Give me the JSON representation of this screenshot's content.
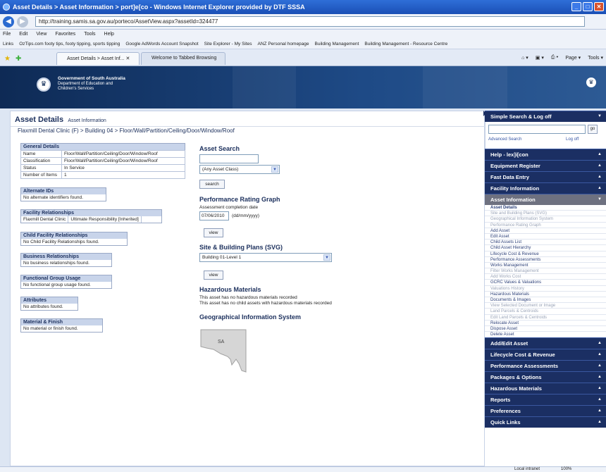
{
  "window": {
    "title": "Asset Details > Asset Information > port]e[co - Windows Internet Explorer provided by DTF SSSA",
    "url": "http://training.samis.sa.gov.au/porteco/AssetView.aspx?assetId=324477"
  },
  "menu": [
    "File",
    "Edit",
    "View",
    "Favorites",
    "Tools",
    "Help"
  ],
  "links": {
    "label": "Links",
    "items": [
      "OzTips.com footy tips, footy tipping, sports tipping",
      "Google AdWords Account Snapshot",
      "Site Explorer - My Sites",
      "ANZ Personal homepage",
      "Building Management",
      "Building Management - Resource Centre"
    ]
  },
  "tabs": [
    {
      "label": "Asset Details > Asset Inf..."
    },
    {
      "label": "Welcome to Tabbed Browsing"
    }
  ],
  "toolbar_right": [
    "Page ▾",
    "Tools ▾"
  ],
  "banner": {
    "line1": "Government of South Australia",
    "line2": "Department of Education and",
    "line3": "Children's Services"
  },
  "page": {
    "title": "Asset Details",
    "subtitle": "Asset Information",
    "path": "Flaxmill Dental Clinic (F) > Building 04 > Floor/Wall/Partition/Ceiling/Door/Window/Roof"
  },
  "general_details": {
    "header": "General Details",
    "rows": [
      {
        "label": "Name",
        "value": "Floor/Wall/Partition/Ceiling/Door/Window/Roof"
      },
      {
        "label": "Classification",
        "value": "Floor/Wall/Partition/Ceiling/Door/Window/Roof"
      },
      {
        "label": "Status",
        "value": "In Service"
      },
      {
        "label": "Number of Items",
        "value": "1"
      }
    ]
  },
  "panels": {
    "alt_ids": {
      "header": "Alternate IDs",
      "body": "No alternate identifiers found."
    },
    "facility": {
      "header": "Facility Relationships",
      "col1": "Flaxmill Dental Clinic",
      "col2": "Ultimate Responsibility [Inherited]"
    },
    "child_facility": {
      "header": "Child Facility Relationships",
      "body": "No Child Facility Relationships found."
    },
    "business": {
      "header": "Business Relationships",
      "body": "No business relationships found."
    },
    "functional": {
      "header": "Functional Group Usage",
      "body": "No functional group usage found."
    },
    "attributes": {
      "header": "Attributes",
      "body": "No attributes found."
    },
    "material": {
      "header": "Material & Finish",
      "body": "No material or finish found."
    }
  },
  "asset_search": {
    "header": "Asset Search",
    "input_value": "",
    "class_select": "(Any Asset Class)",
    "button": "search"
  },
  "rating_graph": {
    "header": "Performance Rating Graph",
    "date_label": "Assessment completion date",
    "date_value": "07/06/2010",
    "date_hint": "(dd/mm/yyyy)",
    "button": "view"
  },
  "site_plans": {
    "header": "Site & Building Plans (SVG)",
    "select": "Building 01-Level 1",
    "button": "view"
  },
  "hazardous": {
    "header": "Hazardous Materials",
    "line1": "This asset has no hazardous materials recorded",
    "line2": "This asset has no child assets with hazardous materials recorded"
  },
  "gis": {
    "header": "Geographical Information System",
    "map_label": "SA"
  },
  "sidebar": {
    "search_header": "Simple Search & Log off",
    "go": "go",
    "advanced": "Advanced Search",
    "logoff": "Log off",
    "sections_top": [
      "Help - lex]i[con",
      "Equipment Register",
      "Fast Data Entry",
      "Facility Information"
    ],
    "asset_info_header": "Asset Information",
    "asset_info_items": [
      {
        "label": "Asset Details",
        "state": "current"
      },
      {
        "label": "Site and Building Plans (SVG)",
        "state": "disabled"
      },
      {
        "label": "Geographical Information System",
        "state": "disabled"
      },
      {
        "label": "Performance Rating Graph",
        "state": "disabled"
      },
      {
        "label": "Add Asset",
        "state": "normal"
      },
      {
        "label": "Edit Asset",
        "state": "normal"
      },
      {
        "label": "Child Assets List",
        "state": "normal"
      },
      {
        "label": "Child Asset Hierarchy",
        "state": "normal"
      },
      {
        "label": "Lifecycle Cost & Revenue",
        "state": "normal"
      },
      {
        "label": "Performance Assessments",
        "state": "normal"
      },
      {
        "label": "Works Management",
        "state": "normal"
      },
      {
        "label": "Filter Works Management",
        "state": "disabled"
      },
      {
        "label": "Add Works Cost",
        "state": "disabled"
      },
      {
        "label": "GCRC Values & Valuations",
        "state": "normal"
      },
      {
        "label": "Valuations History",
        "state": "disabled"
      },
      {
        "label": "Hazardous Materials",
        "state": "normal"
      },
      {
        "label": "Documents & Images",
        "state": "normal"
      },
      {
        "label": "View Selected Document or Image",
        "state": "disabled"
      },
      {
        "label": "Land Parcels & Centroids",
        "state": "disabled"
      },
      {
        "label": "Edit Land Parcels & Centroids",
        "state": "disabled"
      },
      {
        "label": "Relocate Asset",
        "state": "normal"
      },
      {
        "label": "Dispose Asset",
        "state": "normal"
      },
      {
        "label": "Delete Asset",
        "state": "normal"
      }
    ],
    "sections_bottom": [
      "Add/Edit Asset",
      "Lifecycle Cost & Revenue",
      "Performance Assessments",
      "Packages & Options",
      "Hazardous Materials",
      "Reports",
      "Preferences",
      "Quick Links"
    ]
  },
  "status": {
    "zone": "Local intranet",
    "zoom": "100%"
  }
}
